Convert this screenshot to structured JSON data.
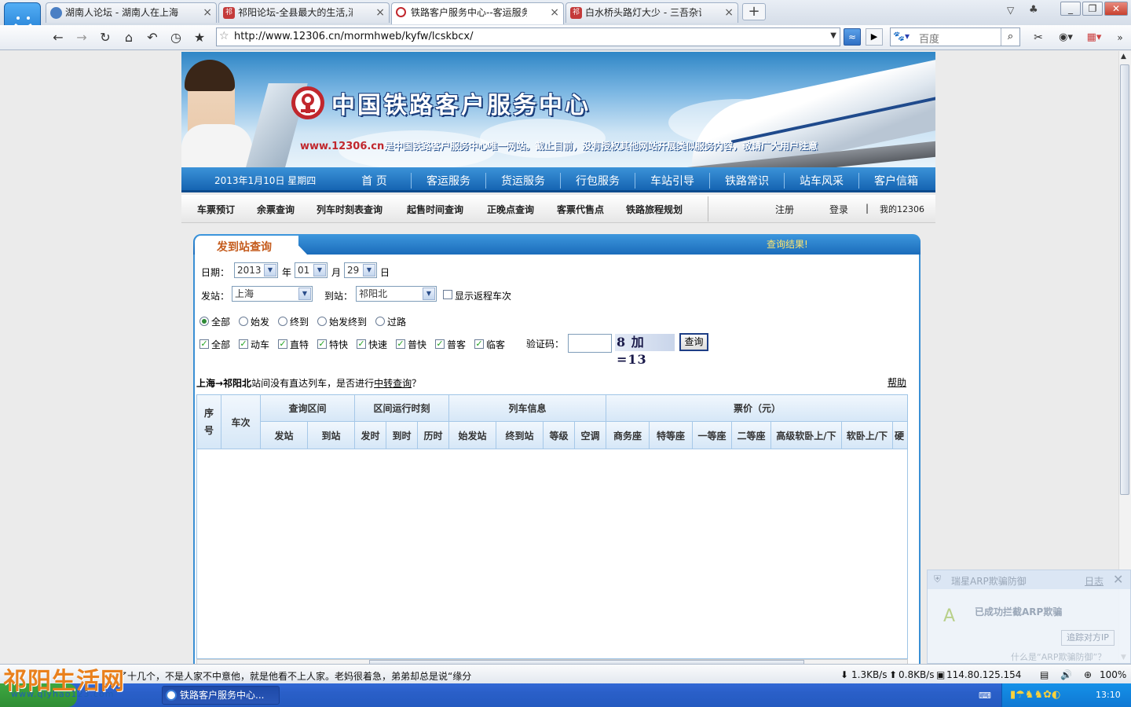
{
  "tabs": [
    {
      "label": "湖南人论坛 - 湖南人在上海 ...",
      "icon_color": "#4a7fc4"
    },
    {
      "label": "祁阳论坛-全县最大的生活,消...",
      "icon_color": "#c43a3a"
    },
    {
      "label": "铁路客户服务中心--客运服务",
      "icon_color": "#c1272d"
    },
    {
      "label": "白水桥头路灯大少 - 三吾杂谈...",
      "icon_color": "#c43a3a"
    }
  ],
  "tab_icon_text": "祁",
  "browser": {
    "url": "http://www.12306.cn/mormhweb/kyfw/lcskbcx/",
    "search_placeholder": "百度",
    "new_tab": "+"
  },
  "banner": {
    "title": "中国铁路客户服务中心",
    "site": "www.12306.cn",
    "notice": "是中国铁路客户服务中心唯一网站。截止目前，没有授权其他网站开展类似服务内容，敬请广大用户注意"
  },
  "nav": {
    "date": "2013年1月10日 星期四",
    "items": [
      "首 页",
      "客运服务",
      "货运服务",
      "行包服务",
      "车站引导",
      "铁路常识",
      "站车风采",
      "客户信箱"
    ]
  },
  "subnav": {
    "items": [
      "车票预订",
      "余票查询",
      "列车时刻表查询",
      "起售时间查询",
      "正晚点查询",
      "客票代售点",
      "铁路旅程规划"
    ],
    "register": "注册",
    "login": "登录",
    "separator": "|",
    "my12306": "我的12306"
  },
  "panel": {
    "title": "发到站查询",
    "result_label": "查询结果!"
  },
  "form": {
    "date_label": "日期：",
    "year": "2013",
    "year_unit": "年",
    "month": "01",
    "month_unit": "月",
    "day": "29",
    "day_unit": "日",
    "from_label": "发站：",
    "from_value": "上海",
    "to_label": "到站：",
    "to_value": "祁阳北",
    "return_label": "显示返程车次",
    "return_checked": false,
    "station_types": [
      {
        "label": "全部",
        "selected": true
      },
      {
        "label": "始发",
        "selected": false
      },
      {
        "label": "终到",
        "selected": false
      },
      {
        "label": "始发终到",
        "selected": false
      },
      {
        "label": "过路",
        "selected": false
      }
    ],
    "train_types": [
      {
        "label": "全部",
        "checked": true
      },
      {
        "label": "动车",
        "checked": true
      },
      {
        "label": "直特",
        "checked": true
      },
      {
        "label": "特快",
        "checked": true
      },
      {
        "label": "快速",
        "checked": true
      },
      {
        "label": "普快",
        "checked": true
      },
      {
        "label": "普客",
        "checked": true
      },
      {
        "label": "临客",
        "checked": true
      }
    ],
    "captcha_label": "验证码：",
    "captcha_text": "8 加 =13",
    "query_button": "查询"
  },
  "result": {
    "route": "上海→祁阳北",
    "message_a": "站间没有直达列车，是否进行",
    "transfer_link": "中转查询",
    "message_b": "？",
    "help": "帮助"
  },
  "table": {
    "group_headers": [
      "序号",
      "车次",
      "查询区间",
      "区间运行时刻",
      "列车信息",
      "票价（元）"
    ],
    "sub_headers": [
      "发站",
      "到站",
      "发时",
      "到时",
      "历时",
      "始发站",
      "终到站",
      "等级",
      "空调",
      "商务座",
      "特等座",
      "一等座",
      "二等座",
      "高级软卧上/下",
      "软卧上/下",
      "硬"
    ]
  },
  "popup": {
    "title": "瑞星ARP欺骗防御",
    "log": "日志",
    "message": "已成功拦截ARP欺骗",
    "button": "追踪对方IP",
    "footer": "什么是“ARP欺骗防御”？"
  },
  "statusbar": {
    "text": "了十几个，不是人家不中意他，就是他看不上人家。老妈很着急，弟弟却总是说“缘分",
    "down": "1.3KB/s",
    "up": "0.8KB/s",
    "ip": "114.80.125.154",
    "zoom": "100%"
  },
  "taskbar": {
    "item": "铁路客户服务中心...",
    "time": "13:10"
  },
  "watermark": {
    "text": "祁阳生活网",
    "url": "www.qiyhao123.com"
  },
  "colors": {
    "nav_blue": "#1564b2",
    "panel_title": "#c45a1b",
    "rail_red": "#c1272d"
  }
}
